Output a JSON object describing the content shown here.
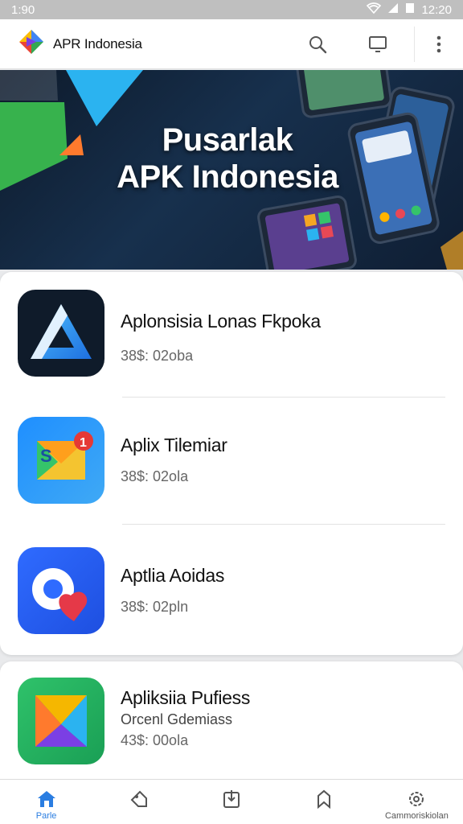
{
  "status_bar": {
    "time_left": "1:90",
    "time_right": "12:20"
  },
  "app_bar": {
    "title": "APR Indonesia"
  },
  "banner": {
    "line1": "Pusarlak",
    "line2": "APK Indonesia"
  },
  "apps": [
    {
      "name": "Aplonsisia Lonas Fkpoka",
      "meta": "38$: 02oba"
    },
    {
      "name": "Aplix Tilemiar",
      "meta": "38$: 02ola"
    },
    {
      "name": "Aptlia Aoidas",
      "meta": "38$: 02pln"
    },
    {
      "name": "Apliksiia Pufiess",
      "subtitle": "Orcenl Gdemiass",
      "meta": "43$: 00ola"
    }
  ],
  "bottom_nav": [
    {
      "label": "Parle",
      "icon": "home-icon",
      "active": true
    },
    {
      "label": "",
      "icon": "tag-icon",
      "active": false
    },
    {
      "label": "",
      "icon": "download-icon",
      "active": false
    },
    {
      "label": "",
      "icon": "bookmark-icon",
      "active": false
    },
    {
      "label": "Cammoriskiolan",
      "icon": "settings-icon",
      "active": false
    }
  ],
  "colors": {
    "accent": "#2a7de1",
    "banner_bg": "#0f1e33"
  }
}
